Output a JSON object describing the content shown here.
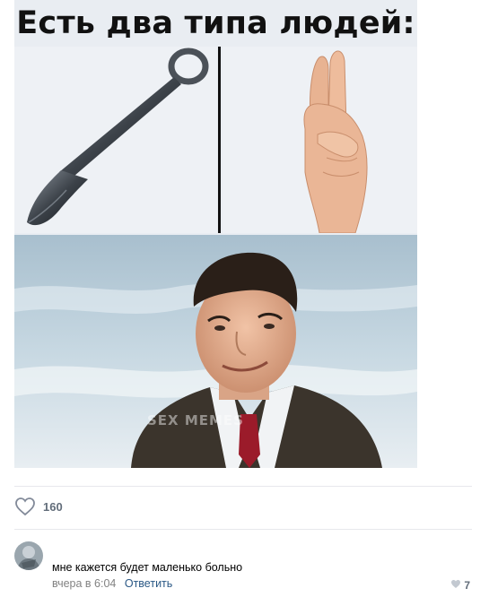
{
  "post": {
    "meme": {
      "title": "Есть два типа людей:",
      "watermark": "SEX MEMES"
    },
    "likes": {
      "icon": "heart-icon",
      "count": "160"
    }
  },
  "comment": {
    "avatar_icon": "avatar",
    "text": "мне кажется будет маленько больно",
    "time": "вчера в 6:04",
    "reply_label": "Ответить",
    "likes_icon": "heart-icon",
    "likes_count": "7"
  },
  "colors": {
    "link": "#2a5885",
    "meta": "#828282",
    "like_grey": "#626d7a"
  }
}
